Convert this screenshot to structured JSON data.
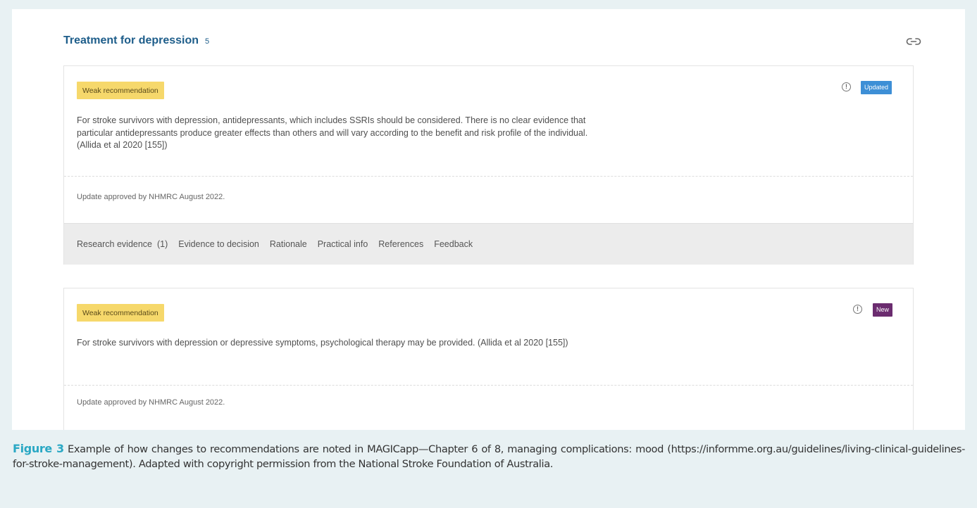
{
  "section": {
    "title": "Treatment for depression",
    "count": "5",
    "link_icon": "link-icon"
  },
  "cards": [
    {
      "strength": "Weak recommendation",
      "status": "Updated",
      "status_color": "#3d8fd6",
      "text": "For stroke survivors with depression, antidepressants, which includes SSRIs should be considered. There is no clear evidence that particular antidepressants produce greater effects than others and will vary according to the benefit and risk profile of the individual. (Allida et al 2020 [155])",
      "approval": "Update approved by NHMRC August 2022.",
      "tabs": [
        "Research evidence  (1)",
        "Evidence to decision",
        "Rationale",
        "Practical info",
        "References",
        "Feedback"
      ]
    },
    {
      "strength": "Weak recommendation",
      "status": "New",
      "status_color": "#6b2c6f",
      "text": "For stroke survivors with depression or depressive symptoms, psychological therapy may be provided. (Allida et al 2020 [155])",
      "approval": "Update approved by NHMRC August 2022."
    }
  ],
  "caption": {
    "label": "Figure 3",
    "text": " Example of how changes to recommendations are noted in MAGICapp—Chapter 6 of 8, managing complications: mood (https://informme.org.au/guidelines/living-clinical-guidelines-for-stroke-management). Adapted with copyright permission from the National Stroke Foundation of Australia."
  },
  "colors": {
    "accent": "#1d5d8a",
    "weak_badge": "#f6d86b",
    "figure_label": "#2aa8c4"
  }
}
